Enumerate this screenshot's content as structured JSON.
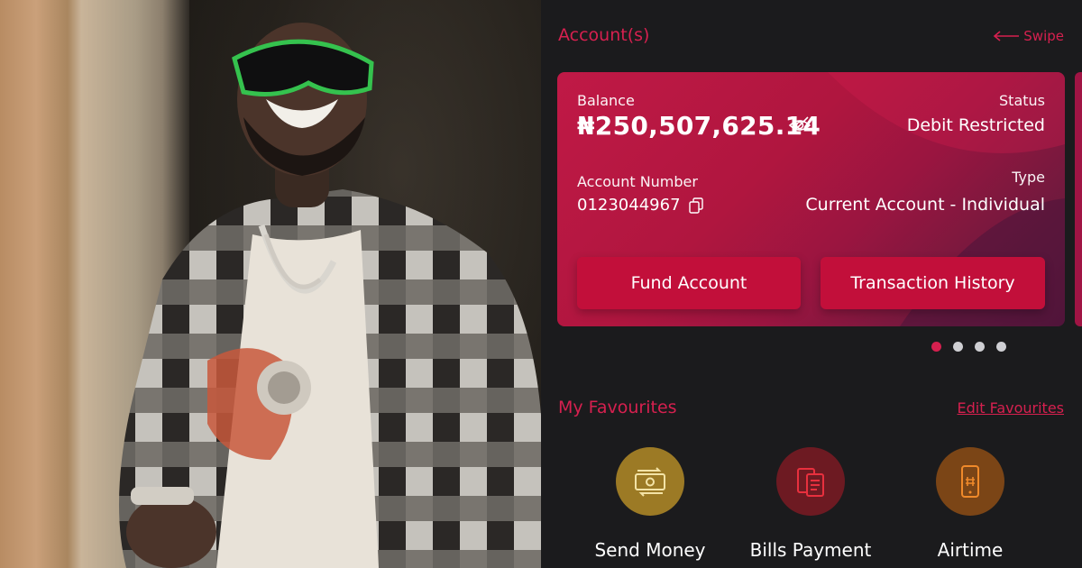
{
  "accounts": {
    "title": "Account(s)",
    "swipe_label": "Swipe",
    "card": {
      "balance_label": "Balance",
      "balance_value": "₦250,507,625.14",
      "status_label": "Status",
      "status_value": "Debit Restricted",
      "account_number_label": "Account Number",
      "account_number_value": "0123044967",
      "type_label": "Type",
      "type_value": "Current Account - Individual",
      "fund_button": "Fund Account",
      "history_button": "Transaction History"
    },
    "pagination": {
      "total": 4,
      "active": 1
    }
  },
  "favourites": {
    "title": "My Favourites",
    "edit_label": "Edit Favourites",
    "items": [
      {
        "label": "Send Money",
        "icon": "cash-transfer-icon",
        "color": "#b28b2a"
      },
      {
        "label": "Bills Payment",
        "icon": "bills-icon",
        "color": "#7a1a24"
      },
      {
        "label": "Airtime",
        "icon": "phone-icon",
        "color": "#8a4e17"
      }
    ]
  },
  "colors": {
    "accent": "#d6204f",
    "background": "#1b1b1d",
    "button": "#c20f3a"
  }
}
